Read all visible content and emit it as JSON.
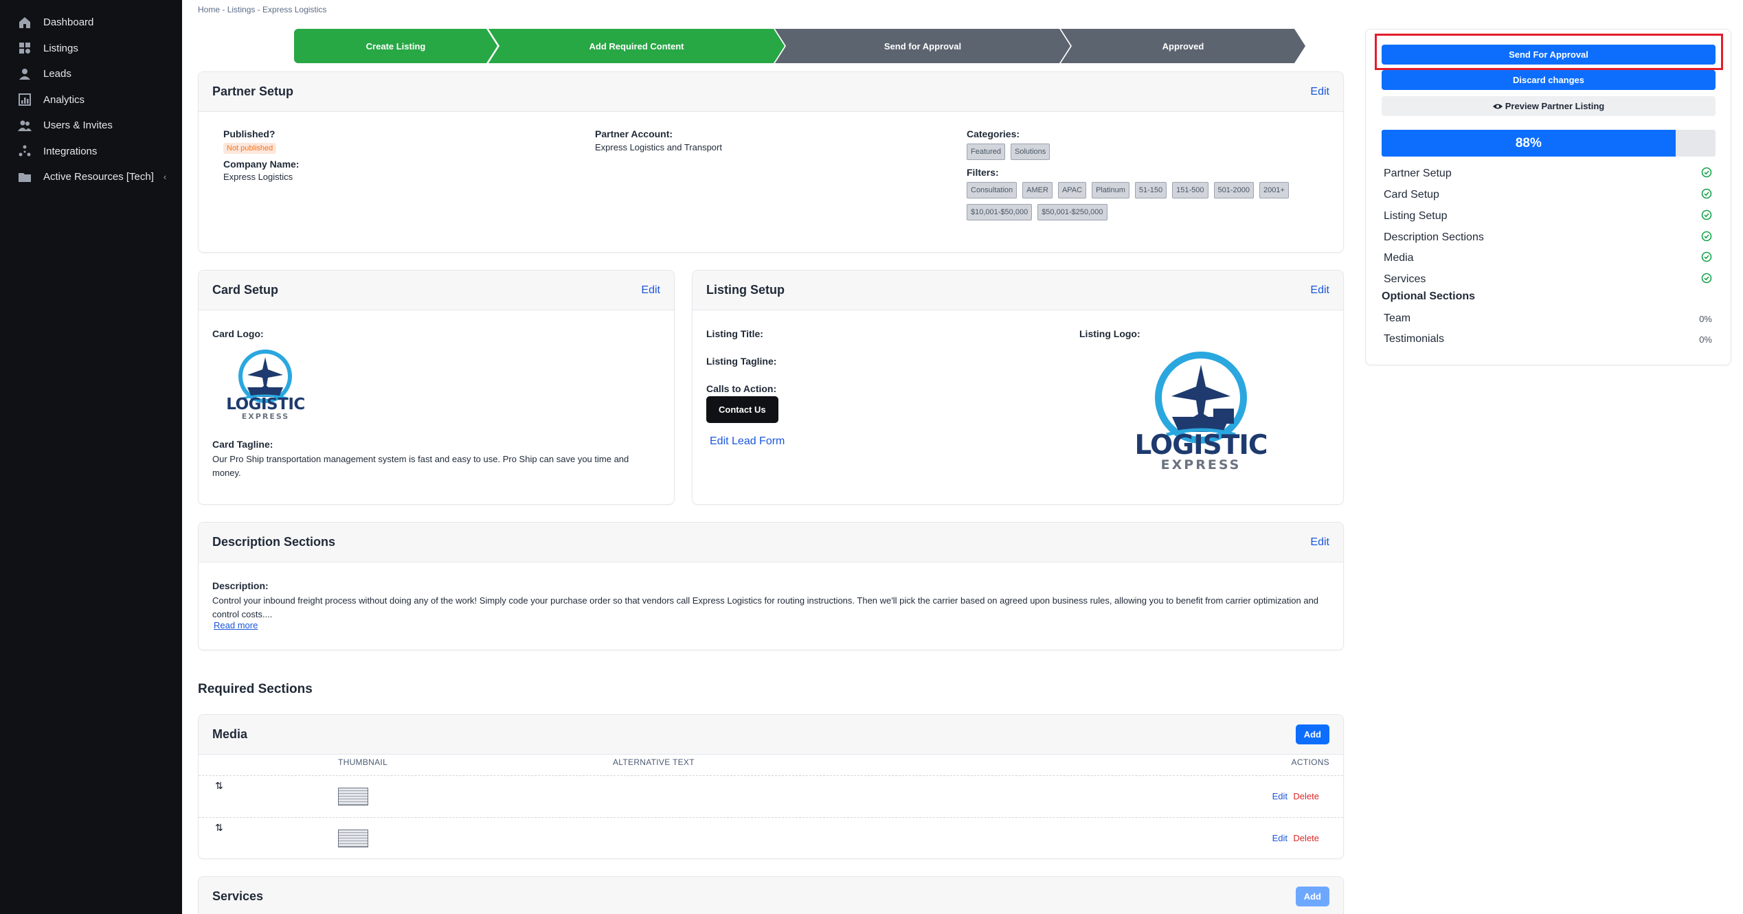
{
  "sidebar": {
    "items": [
      {
        "label": "Dashboard",
        "icon": "home-icon"
      },
      {
        "label": "Listings",
        "icon": "grid-icon"
      },
      {
        "label": "Leads",
        "icon": "person-icon"
      },
      {
        "label": "Analytics",
        "icon": "chart-icon"
      },
      {
        "label": "Users & Invites",
        "icon": "users-icon"
      },
      {
        "label": "Integrations",
        "icon": "nodes-icon"
      },
      {
        "label": "Active Resources [Tech]",
        "icon": "folder-icon",
        "chevron": "‹"
      }
    ]
  },
  "breadcrumb": {
    "home": "Home",
    "sep": " - ",
    "listings": "Listings",
    "current": "Express Logistics"
  },
  "stepper": {
    "steps": [
      {
        "label": "Create Listing",
        "state": "done"
      },
      {
        "label": "Add Required Content",
        "state": "done"
      },
      {
        "label": "Send for Approval",
        "state": "pending"
      },
      {
        "label": "Approved",
        "state": "pending"
      }
    ]
  },
  "partner_setup": {
    "title": "Partner Setup",
    "edit": "Edit",
    "published_label": "Published?",
    "published_value": "Not published",
    "company_label": "Company Name:",
    "company_value": "Express Logistics",
    "account_label": "Partner Account:",
    "account_value": "Express Logistics and Transport",
    "categories_label": "Categories:",
    "categories": [
      "Featured",
      "Solutions"
    ],
    "filters_label": "Filters:",
    "filters": [
      "Consultation",
      "AMER",
      "APAC",
      "Platinum",
      "51-150",
      "151-500",
      "501-2000",
      "2001+",
      "$10,001-$50,000",
      "$50,001-$250,000"
    ]
  },
  "card_setup": {
    "title": "Card Setup",
    "edit": "Edit",
    "logo_label": "Card Logo:",
    "logo_text_top": "LOGISTIC",
    "logo_text_bottom": "EXPRESS",
    "tagline_label": "Card Tagline:",
    "tagline_value": "Our Pro Ship transportation management system is fast and easy to use. Pro Ship can save you time and money."
  },
  "listing_setup": {
    "title": "Listing Setup",
    "edit": "Edit",
    "title_label": "Listing Title:",
    "tagline_label": "Listing Tagline:",
    "cta_label": "Calls to Action:",
    "cta_button": "Contact Us",
    "lead_form_link": "Edit Lead Form",
    "logo_label": "Listing Logo:",
    "logo_text_top": "LOGISTIC",
    "logo_text_bottom": "EXPRESS"
  },
  "description": {
    "title": "Description Sections",
    "edit": "Edit",
    "label": "Description:",
    "value": "Control your inbound freight process without doing any of the work! Simply code your purchase order so that vendors call Express Logistics for routing instructions. Then we'll pick the carrier based on agreed upon business rules, allowing you to benefit from carrier optimization and control costs....",
    "read_more": "Read more"
  },
  "required_sections_title": "Required Sections",
  "media": {
    "title": "Media",
    "add": "Add",
    "columns": [
      "THUMBNAIL",
      "ALTERNATIVE TEXT",
      "ACTIONS"
    ],
    "rows": [
      {
        "handle": "⇅",
        "alt": "",
        "edit": "Edit",
        "delete": "Delete"
      },
      {
        "handle": "⇅",
        "alt": "",
        "edit": "Edit",
        "delete": "Delete"
      }
    ]
  },
  "services": {
    "title": "Services",
    "add": "Add"
  },
  "panel": {
    "send_approval": "Send For Approval",
    "discard": "Discard changes",
    "preview": "Preview Partner Listing",
    "progress_value": 88,
    "progress_label": "88%",
    "required": [
      {
        "label": "Partner Setup",
        "status": "complete"
      },
      {
        "label": "Card Setup",
        "status": "complete"
      },
      {
        "label": "Listing Setup",
        "status": "complete"
      },
      {
        "label": "Description Sections",
        "status": "complete"
      },
      {
        "label": "Media",
        "status": "complete"
      },
      {
        "label": "Services",
        "status": "complete"
      }
    ],
    "optional_title": "Optional Sections",
    "optional": [
      {
        "label": "Team",
        "pct": "0%"
      },
      {
        "label": "Testimonials",
        "pct": "0%"
      }
    ]
  },
  "colors": {
    "green": "#28a745",
    "gray_step": "#5c6470",
    "primary": "#0d6efd",
    "sidebar": "#101114",
    "danger": "#dc2626",
    "check": "#16a34a",
    "highlight": "#e11d2a"
  }
}
